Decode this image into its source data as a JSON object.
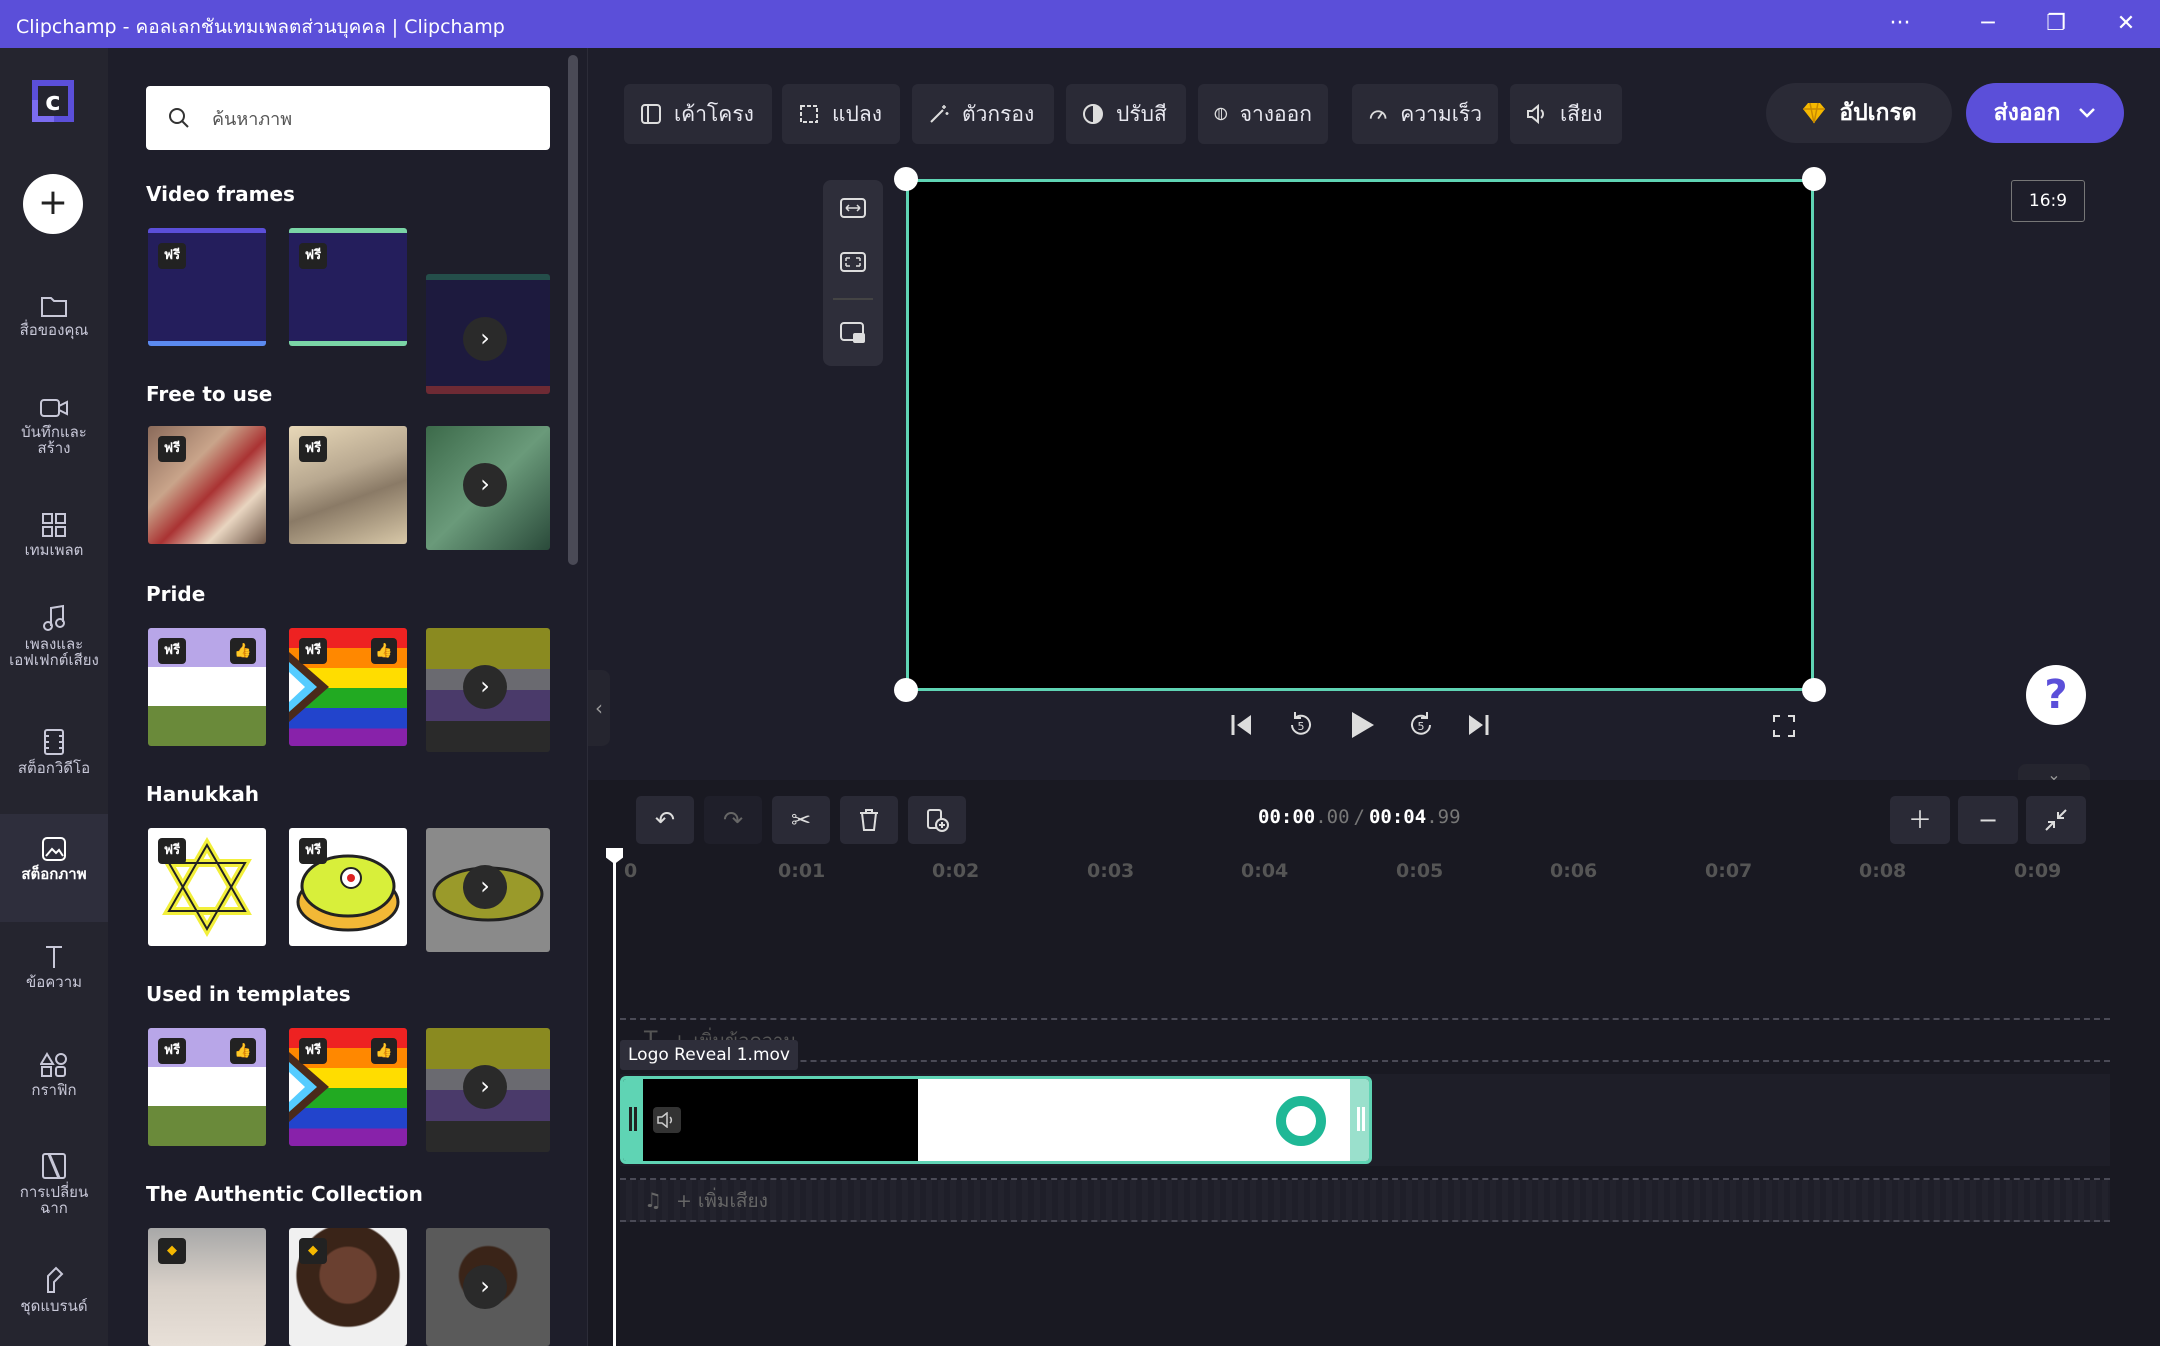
{
  "window": {
    "title": "Clipchamp - คอลเลกชันเทมเพลตส่วนบุคคล | Clipchamp",
    "more": "···",
    "minimize": "─",
    "restore": "❐",
    "close": "✕"
  },
  "rail": {
    "create_label": "+",
    "items": [
      {
        "label": "สื่อของคุณ",
        "icon": "folder-icon"
      },
      {
        "label": "บันทึกและสร้าง",
        "icon": "camera-icon"
      },
      {
        "label": "เทมเพลต",
        "icon": "templates-icon"
      },
      {
        "label": "เพลงและเอฟเฟกต์เสียง",
        "icon": "music-icon"
      },
      {
        "label": "สต็อกวิดีโอ",
        "icon": "film-icon"
      },
      {
        "label": "สต็อกภาพ",
        "icon": "image-icon"
      },
      {
        "label": "ข้อความ",
        "icon": "text-icon"
      },
      {
        "label": "กราฟิก",
        "icon": "shapes-icon"
      },
      {
        "label": "การเปลี่ยนฉาก",
        "icon": "transition-icon"
      },
      {
        "label": "ชุดแบรนด์",
        "icon": "brand-kit-icon"
      }
    ]
  },
  "panel": {
    "search_placeholder": "ค้นหาภาพ",
    "free_badge": "ฟรี",
    "sections": [
      "Video frames",
      "Free to use",
      "Pride",
      "Hanukkah",
      "Used in templates",
      "The Authentic Collection"
    ]
  },
  "toolbar": {
    "items": [
      "เค้าโครง",
      "แปลง",
      "ตัวกรอง",
      "ปรับสี",
      "จางออก",
      "ความเร็ว",
      "เสียง"
    ],
    "upgrade": "อัปเกรด",
    "export": "ส่งออก"
  },
  "preview": {
    "aspect_ratio": "16:9",
    "help": "?"
  },
  "timeline": {
    "current_time": "00:00",
    "current_frac": ".00",
    "separator": "/",
    "total_time": "00:04",
    "total_frac": ".99",
    "ticks": [
      "0",
      "0:01",
      "0:02",
      "0:03",
      "0:04",
      "0:05",
      "0:06",
      "0:07",
      "0:08",
      "0:09"
    ],
    "clip_name": "Logo Reveal 1.mov",
    "add_text": "+ เพิ่มข้อความ",
    "add_audio": "+ เพิ่มเสียง"
  },
  "colors": {
    "accent": "#5b4fd9",
    "selection": "#5fd4b4"
  }
}
